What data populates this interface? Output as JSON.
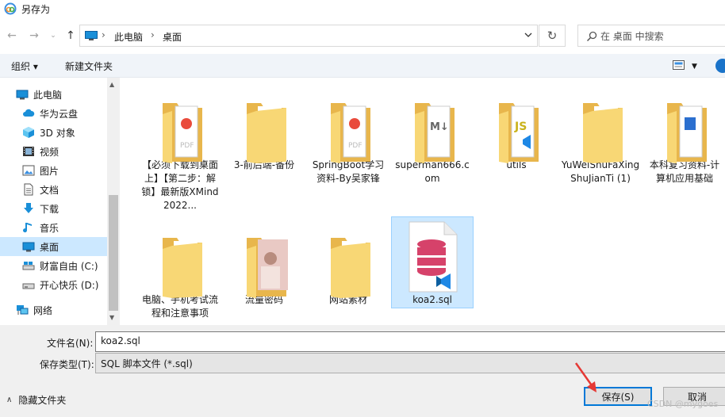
{
  "window": {
    "title": "另存为"
  },
  "address": {
    "crumbs": [
      "此电脑",
      "桌面"
    ],
    "search_placeholder": "在 桌面 中搜索"
  },
  "toolbar": {
    "organize": "组织 ▾",
    "new_folder": "新建文件夹"
  },
  "sidebar": {
    "items": [
      {
        "label": "此电脑",
        "icon": "pc-icon"
      },
      {
        "label": "华为云盘",
        "icon": "cloud-icon"
      },
      {
        "label": "3D 对象",
        "icon": "cube-icon"
      },
      {
        "label": "视频",
        "icon": "video-icon"
      },
      {
        "label": "图片",
        "icon": "picture-icon"
      },
      {
        "label": "文档",
        "icon": "document-icon"
      },
      {
        "label": "下载",
        "icon": "download-icon"
      },
      {
        "label": "音乐",
        "icon": "music-icon"
      },
      {
        "label": "桌面",
        "icon": "desktop-icon"
      },
      {
        "label": "财富自由 (C:)",
        "icon": "drive-c-icon"
      },
      {
        "label": "开心快乐 (D:)",
        "icon": "drive-d-icon"
      },
      {
        "label": "网络",
        "icon": "network-icon"
      }
    ]
  },
  "files": [
    {
      "name": "【必须下载到桌面上】【第二步：解锁】最新版XMind2022...",
      "type": "folder-pdf"
    },
    {
      "name": "3-前后端-备份",
      "type": "folder"
    },
    {
      "name": "SpringBoot学习资料-By吴家锋",
      "type": "folder-pdf"
    },
    {
      "name": "superman666.com",
      "type": "folder-md"
    },
    {
      "name": "utils",
      "type": "folder-js"
    },
    {
      "name": "YuWeiShuFaXingShuJianTi (1)",
      "type": "folder"
    },
    {
      "name": "本科复习资料-计算机应用基础",
      "type": "folder-doc"
    },
    {
      "name": "电脑、手机考试流程和注意事项",
      "type": "folder"
    },
    {
      "name": "流量密码",
      "type": "folder-photo"
    },
    {
      "name": "网站素材",
      "type": "folder"
    },
    {
      "name": "koa2.sql",
      "type": "sql-file"
    }
  ],
  "form": {
    "filename_label": "文件名(N):",
    "filename_value": "koa2.sql",
    "type_label": "保存类型(T):",
    "type_value": "SQL 脚本文件 (*.sql)",
    "hide_folders": "隐藏文件夹",
    "save": "保存(S)",
    "cancel": "取消"
  },
  "watermark": "CSDN @mygoes",
  "colors": {
    "accent": "#0078d7",
    "selection": "#cce8ff",
    "folder": "#f8d775",
    "sql": "#d6426a",
    "annotation": "#e53935"
  }
}
